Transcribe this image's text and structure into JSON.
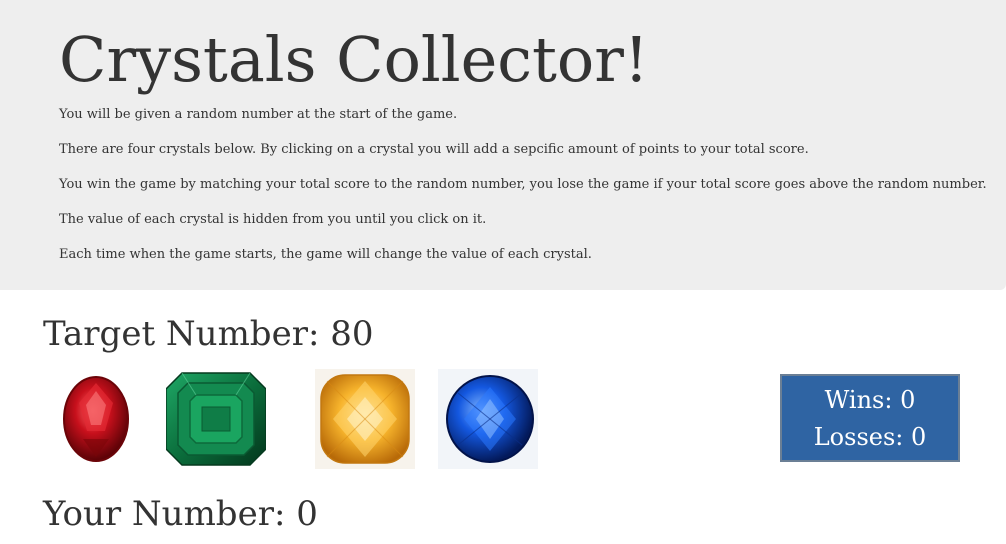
{
  "header": {
    "title": "Crystals Collector!",
    "instructions": [
      "You will be given a random number at the start of the game.",
      "There are four crystals below. By clicking on a crystal you will add a sepcific amount of points to your total score.",
      "You win the game by matching your total score to the random number, you lose the game if your total score goes above the random number.",
      "The value of each crystal is hidden from you until you click on it.",
      "Each time when the game starts, the game will change the value of each crystal."
    ]
  },
  "game": {
    "target_label": "Target Number: 80",
    "your_number_label": "Your Number: 0",
    "crystals": [
      {
        "name": "ruby-crystal",
        "color": "#b3121a"
      },
      {
        "name": "emerald-crystal",
        "color": "#0e7a44"
      },
      {
        "name": "citrine-crystal",
        "color": "#f0a21c"
      },
      {
        "name": "sapphire-crystal",
        "color": "#1553d6"
      }
    ],
    "scoreboard": {
      "wins_label": "Wins: 0",
      "losses_label": "Losses: 0",
      "background_color": "#2f64a3"
    }
  }
}
